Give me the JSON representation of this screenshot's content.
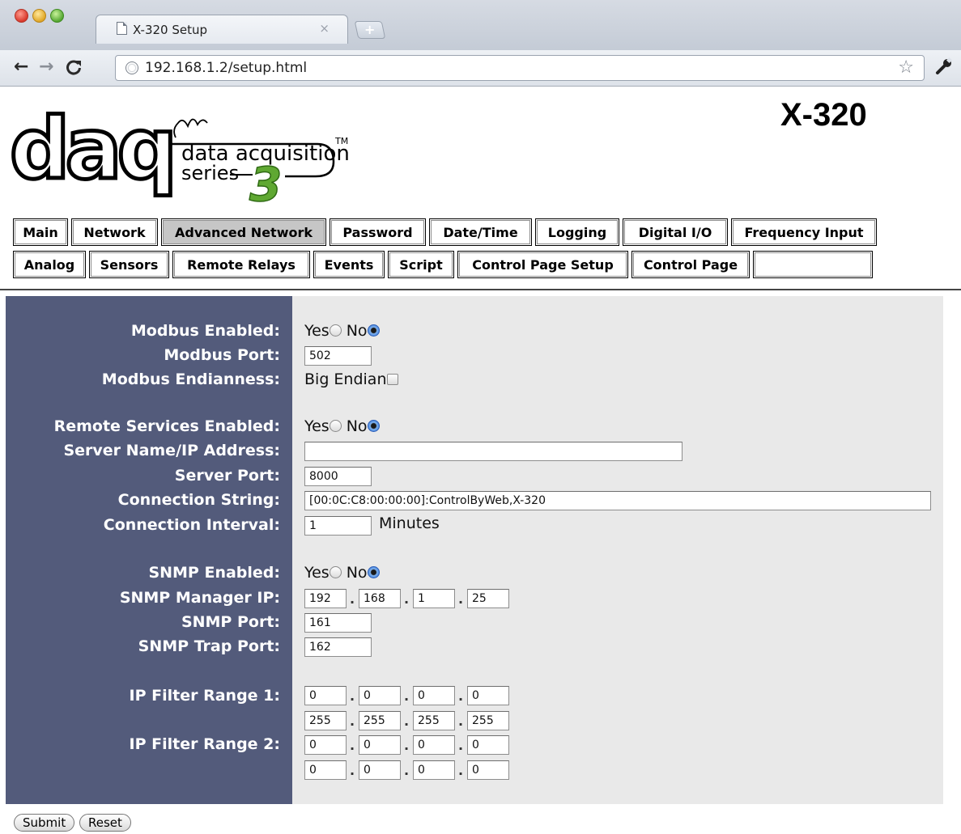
{
  "browser": {
    "tab_title": "X-320 Setup",
    "tab_close": "×",
    "new_tab": "+",
    "url": "192.168.1.2/setup.html"
  },
  "icons": {
    "back": "arrow-left-icon",
    "forward": "arrow-right-icon",
    "reload": "reload-icon",
    "site": "globe-icon",
    "bookmark": "star-icon",
    "menu": "wrench-icon"
  },
  "header": {
    "logo_text": "daq",
    "logo_tagline_1": "data acquisition",
    "logo_tagline_2": "series",
    "logo_series_number": "3",
    "logo_tm": "TM",
    "device_title": "X-320"
  },
  "nav": {
    "row1": [
      "Main",
      "Network",
      "Advanced Network",
      "Password",
      "Date/Time",
      "Logging",
      "Digital I/O",
      "Frequency Input"
    ],
    "row2": [
      "Analog",
      "Sensors",
      "Remote Relays",
      "Events",
      "Script",
      "Control Page Setup",
      "Control Page",
      ""
    ],
    "active": "Advanced Network"
  },
  "form": {
    "modbus_enabled": {
      "label": "Modbus Enabled:",
      "yes": "Yes",
      "no": "No",
      "selected": "No"
    },
    "modbus_port": {
      "label": "Modbus Port:",
      "value": "502"
    },
    "modbus_endianness": {
      "label": "Modbus Endianness:",
      "option": "Big Endian",
      "checked": false
    },
    "remote_services_enabled": {
      "label": "Remote Services Enabled:",
      "yes": "Yes",
      "no": "No",
      "selected": "No"
    },
    "server_name": {
      "label": "Server Name/IP Address:",
      "value": ""
    },
    "server_port": {
      "label": "Server Port:",
      "value": "8000"
    },
    "connection_string": {
      "label": "Connection String:",
      "value": "[00:0C:C8:00:00:00]:ControlByWeb,X-320"
    },
    "connection_interval": {
      "label": "Connection Interval:",
      "value": "1",
      "unit": "Minutes"
    },
    "snmp_enabled": {
      "label": "SNMP Enabled:",
      "yes": "Yes",
      "no": "No",
      "selected": "No"
    },
    "snmp_manager_ip": {
      "label": "SNMP Manager IP:",
      "octets": [
        "192",
        "168",
        "1",
        "25"
      ]
    },
    "snmp_port": {
      "label": "SNMP Port:",
      "value": "161"
    },
    "snmp_trap_port": {
      "label": "SNMP Trap Port:",
      "value": "162"
    },
    "ip_filter_1": {
      "label": "IP Filter Range 1:",
      "start": [
        "0",
        "0",
        "0",
        "0"
      ],
      "end": [
        "255",
        "255",
        "255",
        "255"
      ]
    },
    "ip_filter_2": {
      "label": "IP Filter Range 2:",
      "start": [
        "0",
        "0",
        "0",
        "0"
      ],
      "end": [
        "0",
        "0",
        "0",
        "0"
      ]
    },
    "ip_dot": "."
  },
  "actions": {
    "submit": "Submit",
    "reset": "Reset"
  },
  "colors": {
    "label_panel": "#535b7b",
    "field_panel": "#e9e9e9",
    "radio_selected": "#3a78d6",
    "logo_green": "#5fa832"
  }
}
